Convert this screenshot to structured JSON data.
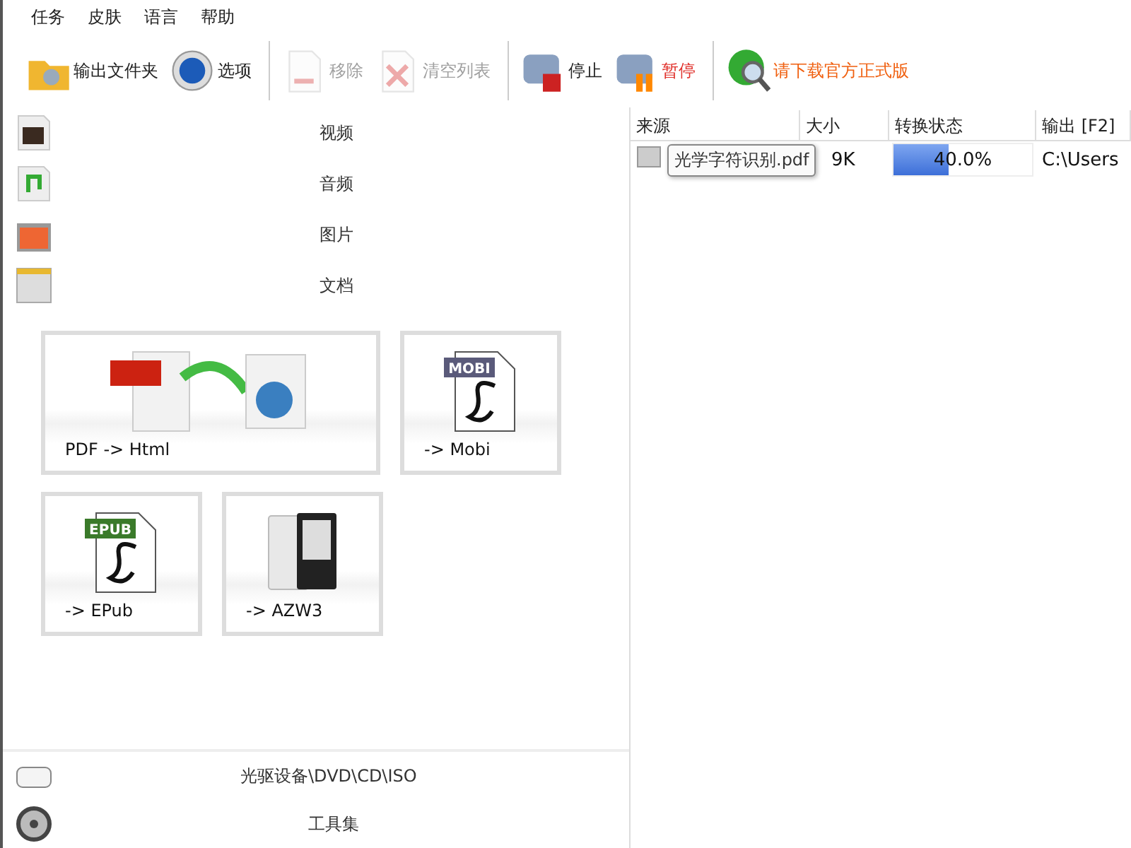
{
  "menu": [
    "任务",
    "皮肤",
    "语言",
    "帮助"
  ],
  "toolbar": [
    [
      {
        "label": "输出文件夹",
        "disabled": false,
        "color": "#222222"
      },
      {
        "label": "选项",
        "disabled": false,
        "color": "#222222"
      }
    ],
    [
      {
        "label": "移除",
        "disabled": true,
        "color": "#a0a0a0"
      },
      {
        "label": "清空列表",
        "disabled": true,
        "color": "#a0a0a0"
      }
    ],
    [
      {
        "label": "停止",
        "disabled": false,
        "color": "#222222"
      },
      {
        "label": "暂停",
        "disabled": false,
        "color": "#e0302a"
      }
    ],
    [
      {
        "label": "请下载官方正式版",
        "disabled": false,
        "color": "#f06010"
      }
    ]
  ],
  "categories": [
    "视频",
    "音频",
    "图片",
    "文档"
  ],
  "converters": [
    {
      "label": "PDF -> Html",
      "kind": "pdf-html"
    },
    {
      "label": "-> Mobi",
      "kind": "mobi",
      "badge": "MOBI"
    },
    {
      "label": "-> EPub",
      "kind": "epub",
      "badge": "EPUB"
    },
    {
      "label": "-> AZW3",
      "kind": "azw3"
    }
  ],
  "bottom": [
    "光驱设备\\DVD\\CD\\ISO",
    "工具集"
  ],
  "table": {
    "columns": [
      "来源",
      "大小",
      "转换状态",
      "输出 [F2]"
    ],
    "rows": [
      {
        "size": "9K",
        "status": "40.0%",
        "level": 0.4,
        "output": "C:\\Users"
      }
    ],
    "tooltip": "光学字符识别.pdf"
  }
}
